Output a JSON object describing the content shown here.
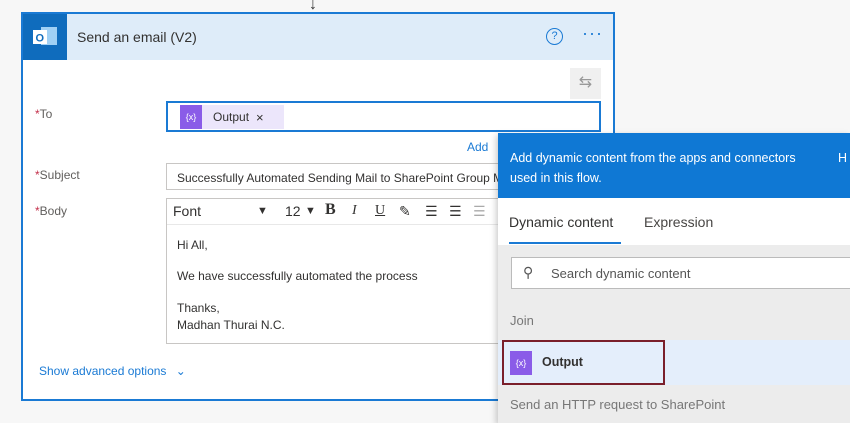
{
  "card": {
    "title": "Send an email (V2)",
    "help_icon": "question-circle",
    "more_icon": "ellipsis"
  },
  "form": {
    "to_label": "To",
    "to_token": "Output",
    "to_token_remove": "×",
    "add_link": "Add",
    "subject_label": "Subject",
    "subject_value": "Successfully Automated Sending Mail to SharePoint Group M",
    "body_label": "Body",
    "toolbar": {
      "font": "Font",
      "size": "12",
      "bold": "B",
      "italic": "I",
      "underline": "U"
    },
    "body_lines": [
      "Hi All,",
      "We have successfully automated the process",
      "Thanks,",
      "Madhan Thurai N.C."
    ],
    "advanced": "Show advanced options"
  },
  "panel": {
    "header": "Add dynamic content from the apps and connectors used in this flow.",
    "header_extra": "H",
    "tabs": [
      "Dynamic content",
      "Expression"
    ],
    "search_placeholder": "Search dynamic content",
    "group1": "Join",
    "item1": "Output",
    "group2": "Send an HTTP request to SharePoint"
  },
  "colors": {
    "accent": "#0078d4",
    "token": "#8a5ce8",
    "highlight_border": "#7a1f2b"
  }
}
